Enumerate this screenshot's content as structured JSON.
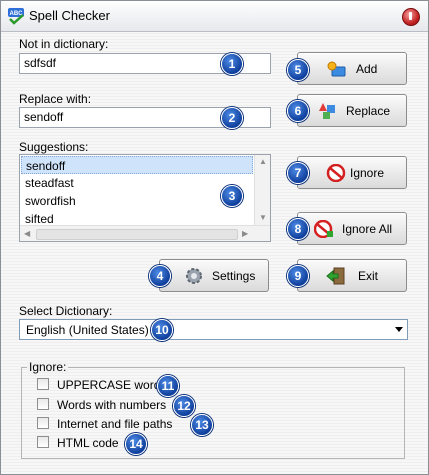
{
  "window": {
    "title": "Spell Checker"
  },
  "not_in_dictionary": {
    "label": "Not in dictionary:",
    "value": "sdfsdf"
  },
  "replace_with": {
    "label": "Replace with:",
    "value": "sendoff"
  },
  "suggestions": {
    "label": "Suggestions:",
    "items": [
      "sendoff",
      "steadfast",
      "swordfish",
      "sifted"
    ],
    "selected_index": 0
  },
  "buttons": {
    "add": "Add",
    "replace": "Replace",
    "ignore": "Ignore",
    "ignore_all": "Ignore All",
    "settings": "Settings",
    "exit": "Exit"
  },
  "dictionary": {
    "label": "Select Dictionary:",
    "value": "English (United States)"
  },
  "ignore": {
    "title": "Ignore:",
    "options": [
      {
        "label": "UPPERCASE words",
        "checked": false
      },
      {
        "label": "Words with numbers",
        "checked": false
      },
      {
        "label": "Internet and file paths",
        "checked": false
      },
      {
        "label": "HTML code",
        "checked": false
      }
    ]
  },
  "badges": [
    "1",
    "2",
    "3",
    "4",
    "5",
    "6",
    "7",
    "8",
    "9",
    "10",
    "11",
    "12",
    "13",
    "14"
  ],
  "colors": {
    "badge": "#1a4fb0",
    "selection": "#cfe3fb"
  }
}
